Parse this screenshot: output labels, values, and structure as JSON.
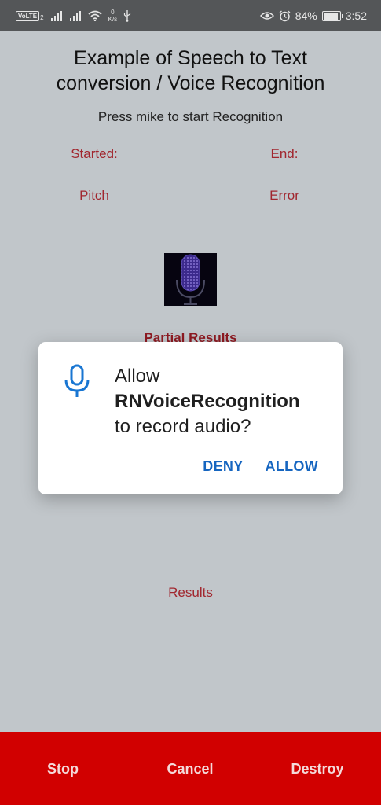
{
  "status_bar": {
    "volte": "VoLTE",
    "volte_sub": "2",
    "net_speed_value": "0",
    "net_speed_unit": "K/s",
    "battery_percent": "84%",
    "battery_level": 0.84,
    "time": "3:52",
    "icons": [
      "signal-icon",
      "signal-icon",
      "wifi-icon",
      "usb-icon",
      "eye-icon",
      "alarm-icon",
      "battery-icon"
    ]
  },
  "main": {
    "title_line1": "Example of Speech to Text",
    "title_line2": "conversion / Voice Recognition",
    "subtitle": "Press mike to start Recognition",
    "started_label": "Started:",
    "end_label": "End:",
    "pitch_label": "Pitch",
    "error_label": "Error",
    "partial_results_label": "Partial Results",
    "results_label": "Results"
  },
  "dialog": {
    "line1": "Allow",
    "app_name": "RNVoiceRecognition",
    "line3": "to record audio?",
    "deny_label": "DENY",
    "allow_label": "ALLOW",
    "icon": "microphone-icon",
    "accent_color": "#1565c0"
  },
  "bottom_bar": {
    "stop_label": "Stop",
    "cancel_label": "Cancel",
    "destroy_label": "Destroy",
    "background_color": "#d10000"
  }
}
